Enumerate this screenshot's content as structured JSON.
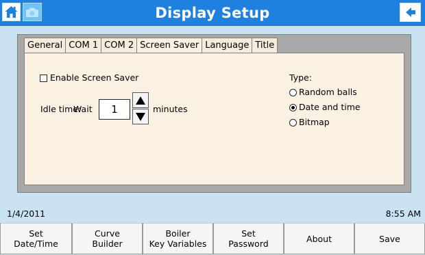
{
  "header": {
    "title": "Display Setup",
    "home_icon": "home-icon",
    "camera_icon": "camera-icon",
    "back_icon": "back-arrow-icon"
  },
  "tabs": [
    {
      "label": "General"
    },
    {
      "label": "COM 1"
    },
    {
      "label": "COM 2"
    },
    {
      "label": "Screen Saver",
      "active": true
    },
    {
      "label": "Language"
    },
    {
      "label": "Title"
    }
  ],
  "screen_saver": {
    "enable_label": "Enable Screen Saver",
    "enabled": false,
    "idle_label": "Idle time:",
    "wait_label": "Wait",
    "idle_value": "1",
    "unit_label": "minutes",
    "type_label": "Type:",
    "types": [
      {
        "label": "Random balls",
        "selected": false
      },
      {
        "label": "Date and time",
        "selected": true
      },
      {
        "label": "Bitmap",
        "selected": false
      }
    ]
  },
  "status": {
    "date": "1/4/2011",
    "time": "8:55 AM"
  },
  "buttons": [
    {
      "label": "Set\nDate/Time"
    },
    {
      "label": "Curve\nBuilder"
    },
    {
      "label": "Boiler\nKey Variables"
    },
    {
      "label": "Set\nPassword"
    },
    {
      "label": "About"
    },
    {
      "label": "Save"
    }
  ],
  "colors": {
    "titlebar": "#1f80df",
    "background": "#c9e3f3",
    "panel": "#fbf1e3"
  }
}
